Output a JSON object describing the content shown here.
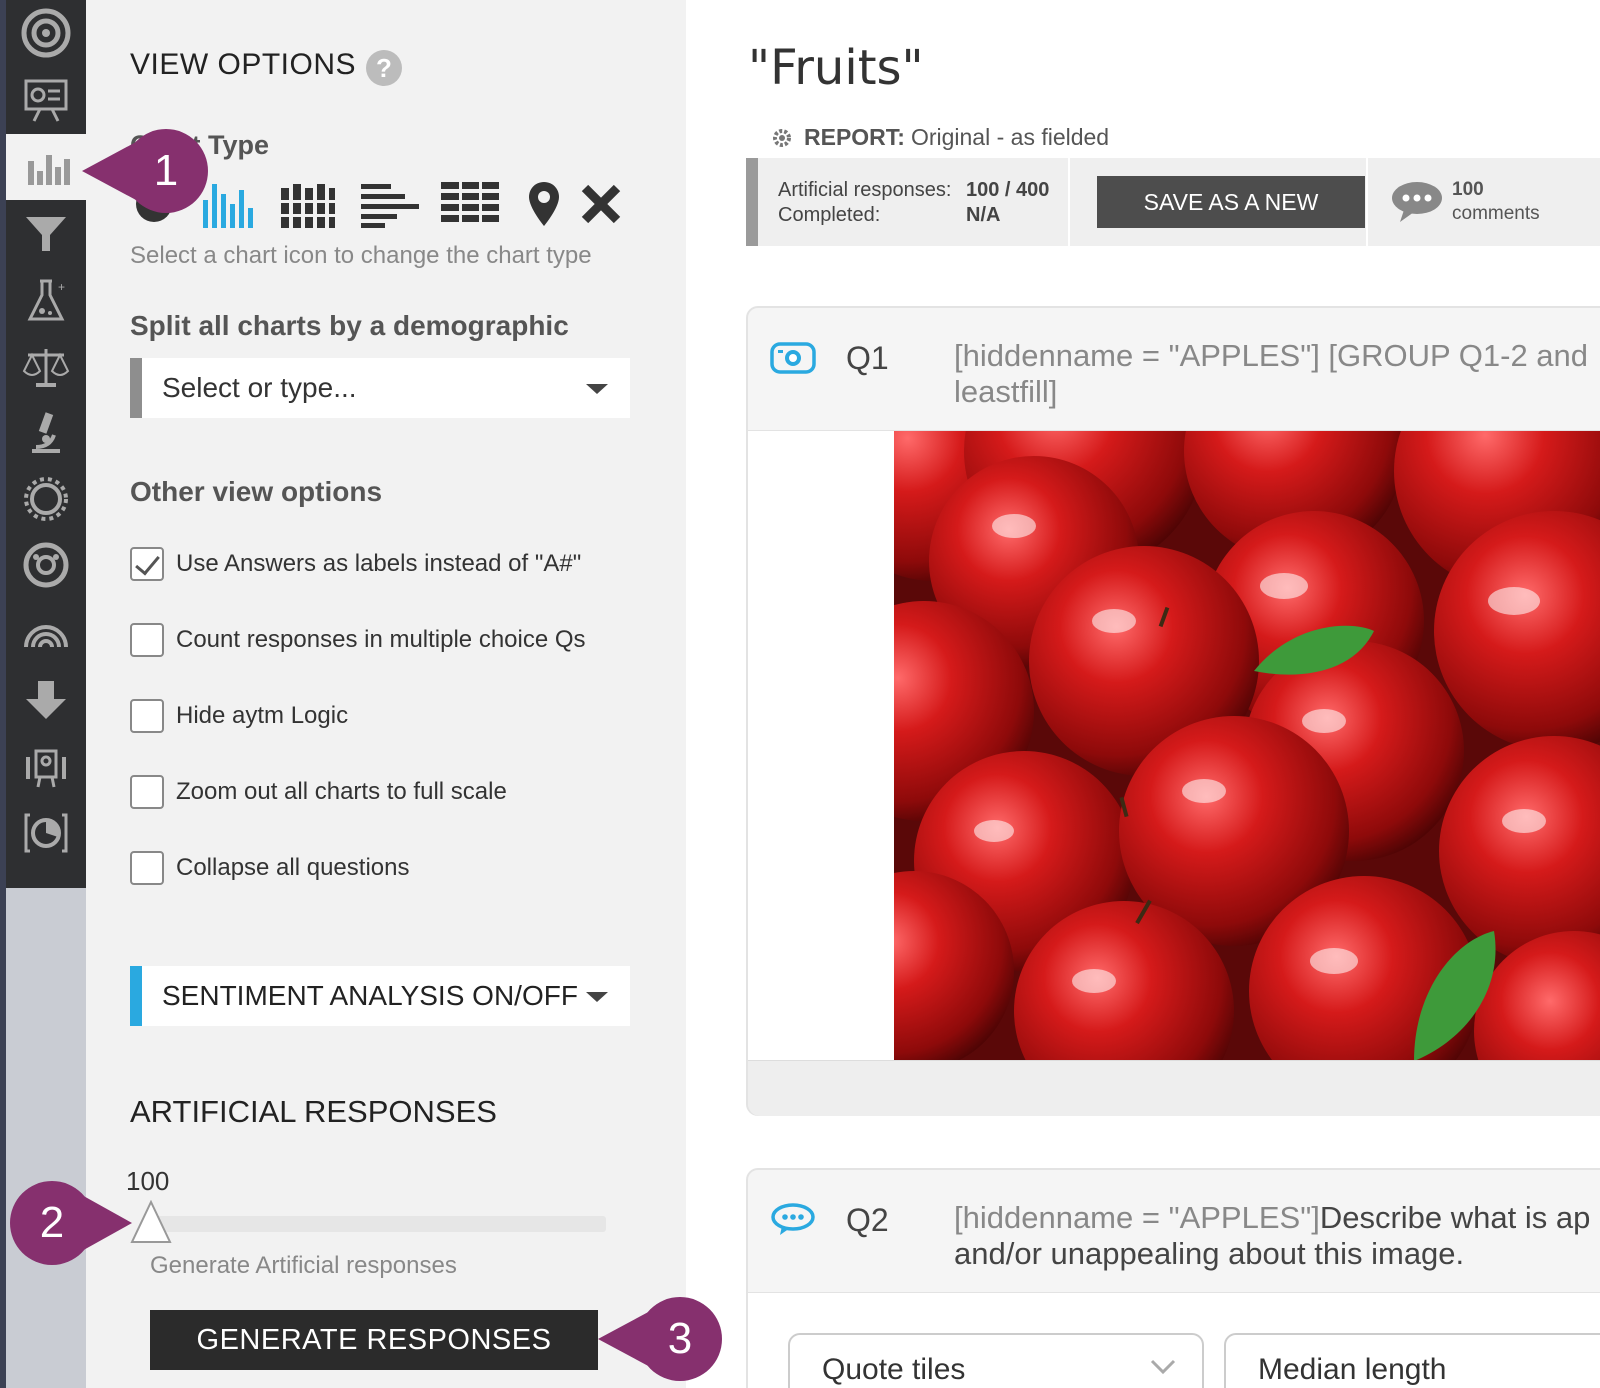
{
  "sidebar": {
    "items": [
      "target-icon",
      "presentation-icon",
      "bar-chart-icon",
      "filter-icon",
      "flask-icon",
      "balance-scale-icon",
      "microscope-icon",
      "sun-icon",
      "gauge-icon",
      "rainbow-icon",
      "download-arrow-icon",
      "robot-icon",
      "pie-chart-icon"
    ],
    "active_item": "bar-chart-icon"
  },
  "view_options": {
    "title": "VIEW OPTIONS",
    "help": "?",
    "chart_type_label": "Chart Type",
    "chart_type_icons": [
      "pie-chart-icon",
      "vertical-bar-chart-icon",
      "stacked-bar-chart-icon",
      "horizontal-bar-chart-icon",
      "stacked-horizontal-bar-icon",
      "map-pin-icon",
      "close-icon"
    ],
    "selected_chart_type": "vertical-bar-chart-icon",
    "chart_hint": "Select a chart icon to change the chart type",
    "split_label": "Split all charts by a demographic",
    "split_placeholder": "Select or type...",
    "other_label": "Other view options",
    "options": [
      {
        "label": "Use Answers as labels instead of \"A#\"",
        "checked": true
      },
      {
        "label": "Count responses in multiple choice Qs",
        "checked": false
      },
      {
        "label": "Hide aytm Logic",
        "checked": false
      },
      {
        "label": "Zoom out all charts to full scale",
        "checked": false
      },
      {
        "label": "Collapse all questions",
        "checked": false
      }
    ],
    "sentiment_label": "SENTIMENT ANALYSIS ON/OFF",
    "artificial": {
      "title": "ARTIFICIAL RESPONSES",
      "value": "100",
      "slider_fraction": 0,
      "hint": "Generate Artificial responses",
      "button": "GENERATE RESPONSES"
    }
  },
  "report": {
    "title": "\"Fruits\"",
    "report_label": "REPORT:",
    "report_value": "Original - as fielded",
    "artificial_label": "Artificial responses:",
    "artificial_value": "100 / 400",
    "completed_label": "Completed:",
    "completed_value": "N/A",
    "save_button": "SAVE AS A NEW REPORT",
    "comments_count": "100",
    "comments_label": "comments"
  },
  "questions": [
    {
      "num": "Q1",
      "icon": "camera-icon",
      "text": "[hiddenname = \"APPLES\"] [GROUP Q1-2 and\nleastfill]"
    },
    {
      "num": "Q2",
      "icon": "speech-bubble-icon",
      "text_prefix": "[hiddenname = \"APPLES\"]",
      "text_main": "Describe what is ap\nand/or unappealing about this image."
    }
  ],
  "q2_controls": {
    "dropdown1": "Quote tiles",
    "dropdown2": "Median length"
  },
  "callouts": [
    "1",
    "2",
    "3"
  ],
  "colors": {
    "accent_blue": "#2aa9e0",
    "callout_purple": "#86306e",
    "rail_dark": "#2e2f31"
  }
}
